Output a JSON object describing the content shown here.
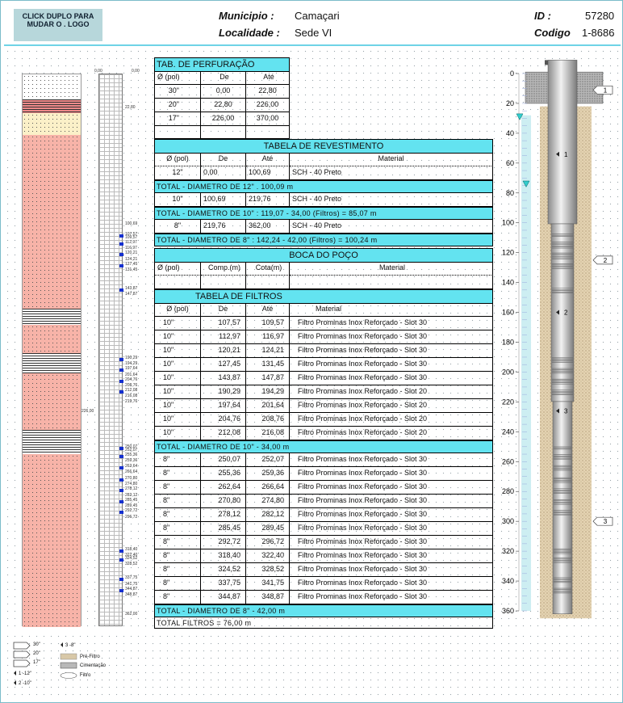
{
  "header": {
    "logo_text": "CLICK DUPLO PARA MUDAR O . LOGO",
    "municipio_label": "Municipio :",
    "municipio_value": "Camaçari",
    "localidade_label": "Localidade :",
    "localidade_value": "Sede VI",
    "id_label": "ID :",
    "id_value": "57280",
    "codigo_label": "Codigo",
    "codigo_value": "1-8686"
  },
  "perfuracao": {
    "title": "TAB. DE PERFURAÇÃO",
    "headers": [
      "Ø  (pol)",
      "De",
      "Até"
    ],
    "rows": [
      [
        "30\"",
        "0,00",
        "22,80"
      ],
      [
        "20\"",
        "22,80",
        "226,00"
      ],
      [
        "17\"",
        "226,00",
        "370,00"
      ]
    ]
  },
  "revestimento": {
    "title": "TABELA DE REVESTIMENTO",
    "headers": [
      "Ø  (pol)",
      "De",
      "Até",
      "Material"
    ],
    "row1": [
      "12\"",
      "0,00",
      "100,69",
      "SCH - 40 Preto"
    ],
    "total1": "TOTAL - DIAMETRO DE  12\" . 100,09 m",
    "row2": [
      "10\"",
      "100,69",
      "219,76",
      "SCH - 40 Preto"
    ],
    "total2": "TOTAL - DIAMETRO DE  10\" : 119,07 - 34,00 (Filtros) = 85,07 m",
    "row3": [
      "8\"",
      "219,76",
      "362,00",
      "SCH - 40 Preto"
    ],
    "total3": "TOTAL - DIAMETRO DE  8\" : 142,24 - 42,00 (Filtros) = 100,24 m"
  },
  "boca": {
    "title": "BOCA DO POÇO",
    "headers": [
      "Ø  (pol)",
      "Comp.(m)",
      "Cota(m)",
      "Material"
    ]
  },
  "filtros": {
    "title": "TABELA DE FILTROS",
    "headers": [
      "Ø  (pol)",
      "De",
      "Até",
      "Material"
    ],
    "rows10": [
      [
        "10\"",
        "107,57",
        "109,57",
        "Filtro Prominas Inox Reforçado - Slot 30"
      ],
      [
        "10\"",
        "112,97",
        "116,97",
        "Filtro Prominas Inox Reforçado - Slot 30"
      ],
      [
        "10\"",
        "120,21",
        "124,21",
        "Filtro Prominas Inox Reforçado - Slot 30"
      ],
      [
        "10\"",
        "127,45",
        "131,45",
        "Filtro Prominas Inox Reforçado - Slot 30"
      ],
      [
        "10\"",
        "143,87",
        "147,87",
        "Filtro Prominas Inox Reforçado - Slot 30"
      ],
      [
        "10\"",
        "190,29",
        "194,29",
        "Filtro Prominas Inox Reforçado - Slot 20"
      ],
      [
        "10\"",
        "197,64",
        "201,64",
        "Filtro Prominas Inox Reforçado - Slot 20"
      ],
      [
        "10\"",
        "204,76",
        "208,76",
        "Filtro Prominas Inox Reforçado - Slot 20"
      ],
      [
        "10\"",
        "212,08",
        "216,08",
        "Filtro Prominas Inox Reforçado - Slot 20"
      ]
    ],
    "total10": "TOTAL - DIAMETRO DE  10\" - 34,00 m",
    "rows8": [
      [
        "8\"",
        "250,07",
        "252,07",
        "Filtro Prominas Inox Reforçado - Slot 30"
      ],
      [
        "8\"",
        "255,36",
        "259,36",
        "Filtro Prominas Inox Reforçado - Slot 30"
      ],
      [
        "8\"",
        "262,64",
        "266,64",
        "Filtro Prominas Inox Reforçado - Slot 30"
      ],
      [
        "8\"",
        "270,80",
        "274,80",
        "Filtro Prominas Inox Reforçado - Slot 30"
      ],
      [
        "8\"",
        "278,12",
        "282,12",
        "Filtro Prominas Inox Reforçado - Slot 30"
      ],
      [
        "8\"",
        "285,45",
        "289,45",
        "Filtro Prominas Inox Reforçado - Slot 30"
      ],
      [
        "8\"",
        "292,72",
        "296,72",
        "Filtro Prominas Inox Reforçado - Slot 30"
      ],
      [
        "8\"",
        "318,40",
        "322,40",
        "Filtro Prominas Inox Reforçado - Slot 30"
      ],
      [
        "8\"",
        "324,52",
        "328,52",
        "Filtro Prominas Inox Reforçado - Slot 30"
      ],
      [
        "8\"",
        "337,75",
        "341,75",
        "Filtro Prominas Inox Reforçado - Slot 30"
      ],
      [
        "8\"",
        "344,87",
        "348,87",
        "Filtro Prominas Inox Reforçado - Slot 30"
      ]
    ],
    "total8": "TOTAL - DIAMETRO DE  8\" - 42,00 m",
    "total_all": "TOTAL FILTROS = 76,00 m"
  },
  "profile": {
    "top_labels": [
      "0,00",
      "0,00"
    ],
    "depth_labels": [
      "22,80",
      "100,69",
      "107,57",
      "109,57",
      "112,97",
      "116,97",
      "120,21",
      "124,21",
      "127,45",
      "131,45",
      "143,87",
      "147,87",
      "190,29",
      "194,29",
      "197,64",
      "201,64",
      "204,76",
      "208,76",
      "212,08",
      "216,08",
      "219,76",
      "226,00",
      "250,07",
      "252,07",
      "255,36",
      "259,36",
      "262,64",
      "266,64",
      "270,80",
      "274,80",
      "278,12",
      "282,12",
      "285,45",
      "289,45",
      "292,72",
      "296,72",
      "318,40",
      "322,40",
      "324,52",
      "328,52",
      "337,75",
      "341,75",
      "344,87",
      "348,87",
      "362,00"
    ],
    "layers": [
      {
        "from": 0,
        "to": 31,
        "color": "#ffffff",
        "pattern": "dots"
      },
      {
        "from": 31,
        "to": 48,
        "color": "#f08a8a",
        "pattern": "lines"
      },
      {
        "from": 48,
        "to": 75,
        "color": "#fbf0c8",
        "pattern": "dots"
      },
      {
        "from": 75,
        "to": 290,
        "color": "#f7b3a8",
        "pattern": "dots"
      },
      {
        "from": 290,
        "to": 310,
        "color": "#ffffff",
        "pattern": "lines"
      },
      {
        "from": 310,
        "to": 345,
        "color": "#f7b3a8",
        "pattern": "dots"
      },
      {
        "from": 345,
        "to": 370,
        "color": "#ffffff",
        "pattern": "lines"
      },
      {
        "from": 370,
        "to": 440,
        "color": "#f7b3a8",
        "pattern": "dots"
      },
      {
        "from": 440,
        "to": 470,
        "color": "#ffffff",
        "pattern": "lines"
      },
      {
        "from": 470,
        "to": 684,
        "color": "#f7b3a8",
        "pattern": "dots"
      }
    ]
  },
  "well": {
    "axis_ticks": [
      "0",
      "20",
      "40",
      "60",
      "80",
      "100",
      "120",
      "140",
      "160",
      "180",
      "200",
      "220",
      "240",
      "260",
      "280",
      "300",
      "320",
      "340",
      "360"
    ],
    "callouts": [
      "1",
      "2",
      "3"
    ],
    "inner_marks": [
      "1",
      "2",
      "3"
    ]
  },
  "legend": {
    "items": [
      "30\"",
      "20\"",
      "17\"",
      "1 -12\"",
      "2 -10\"",
      "3 -8\"",
      "Pré-Filtro",
      "Cimentação",
      "Filtro"
    ]
  }
}
